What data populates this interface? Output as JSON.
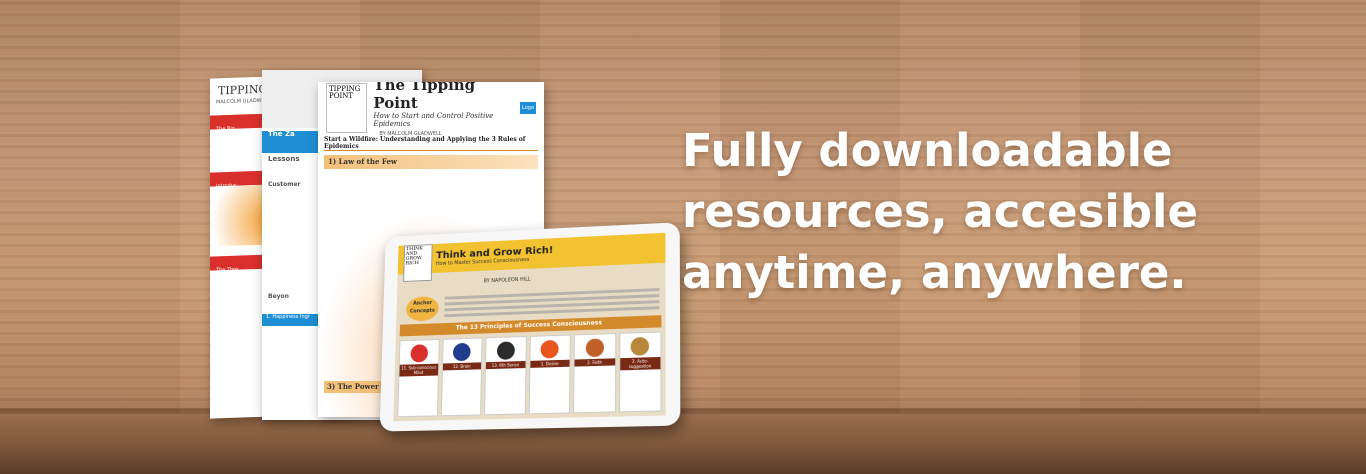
{
  "headline": {
    "line1": "Fully downloadable",
    "line2": "resources, accesible",
    "line3": "anytime, anywhere."
  },
  "page_left": {
    "book_title": "TIPPING POINT",
    "author": "MALCOLM GLADWELL",
    "section1": "The Big",
    "section2": "Introduc",
    "section3": "The Thre"
  },
  "page_middle": {
    "header": "The Za",
    "header2": "Lessons",
    "section1": "Customer",
    "section2": "Beyon",
    "section3": "1. Happiness Ingr"
  },
  "page_right": {
    "book_title": "TIPPING POINT",
    "title": "The Tipping Point",
    "subtitle": "How to Start and Control Positive Epidemics",
    "byline": "BY MALCOLM GLADWELL",
    "logo": "Logo",
    "heading": "Start a Wildfire: Understanding and Applying the 3 Rules of Epidemics",
    "law1": "1) Law of the Few",
    "law3": "3) The Power"
  },
  "tablet": {
    "book_title": "THINK AND GROW RICH",
    "title": "Think and Grow Rich!",
    "subtitle": "How to Master Success Consciousness",
    "byline": "BY NAPOLEON HILL",
    "anchor": "Anchor Concepts",
    "principles": "The 13 Principles of Success Consciousness",
    "tiles": [
      {
        "label": "11. Sub-conscious Mind",
        "color": "#d9302b"
      },
      {
        "label": "12. Brain",
        "color": "#1f3d8a"
      },
      {
        "label": "13. 6th Sense",
        "color": "#2b2b2b"
      },
      {
        "label": "1. Desire",
        "color": "#e8551d"
      },
      {
        "label": "2. Faith",
        "color": "#c0612a"
      },
      {
        "label": "3. Auto-suggestion",
        "color": "#b8873a"
      }
    ]
  }
}
